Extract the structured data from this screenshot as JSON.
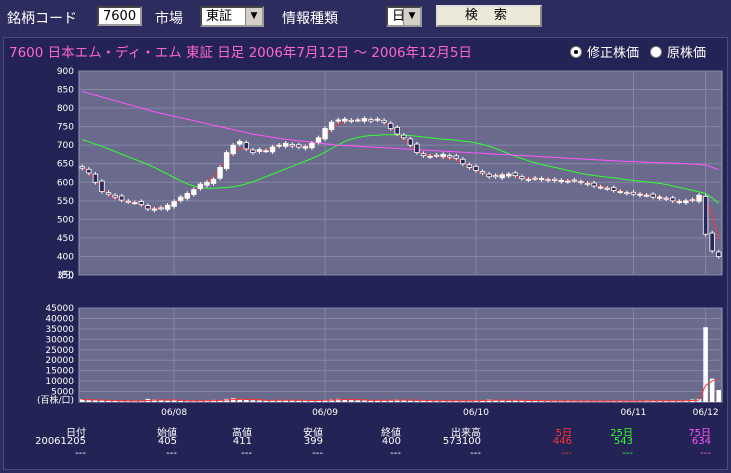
{
  "toolbar": {
    "code_label": "銘柄コード",
    "code_value": "7600",
    "market_label": "市場",
    "market_value": "東証",
    "info_label": "情報種類",
    "info_value": "日足",
    "search_label": "検 索"
  },
  "header": {
    "title": "7600 日本エム・ディ・エム 東証 日足 2006年7月12日 ～ 2006年12月5日",
    "radio_adjusted": "修正株価",
    "radio_raw": "原株価",
    "adjusted_selected": true
  },
  "colors": {
    "background": "#2c2c5e",
    "plot": "#6a6a8c",
    "ma5": "#ff3333",
    "ma25": "#33ff33",
    "ma75": "#ff55ff",
    "title": "#ff66cc"
  },
  "chart_data": [
    {
      "type": "candlestick",
      "y_unit": "(円)",
      "ylim": [
        350,
        900
      ],
      "y_ticks": [
        900,
        850,
        800,
        750,
        700,
        650,
        600,
        550,
        500,
        450,
        400,
        350
      ],
      "grid": true,
      "series": [
        {
          "name": "5日",
          "color": "#ff3333",
          "values": [
            640,
            625,
            605,
            588,
            565,
            558,
            553,
            548,
            546,
            540,
            532,
            530,
            530,
            535,
            545,
            555,
            565,
            577,
            590,
            600,
            615,
            635,
            660,
            680,
            692,
            690,
            685,
            683,
            687,
            693,
            698,
            700,
            698,
            697,
            696,
            700,
            710,
            725,
            743,
            758,
            765,
            767,
            767,
            768,
            768,
            770,
            765,
            750,
            730,
            715,
            698,
            685,
            677,
            672,
            670,
            668,
            665,
            660,
            652,
            643,
            633,
            625,
            618,
            618,
            620,
            620,
            617,
            612,
            610,
            610,
            609,
            608,
            606,
            605,
            605,
            604,
            602,
            598,
            594,
            590,
            585,
            580,
            577,
            572,
            570,
            568,
            566,
            563,
            560,
            555,
            550,
            548,
            548,
            552,
            560,
            560,
            510,
            446
          ]
        },
        {
          "name": "25日",
          "color": "#33ff33",
          "values": [
            715,
            709,
            703,
            697,
            690,
            683,
            676,
            669,
            662,
            655,
            648,
            640,
            631,
            622,
            613,
            604,
            596,
            590,
            586,
            584,
            584,
            585,
            586,
            588,
            591,
            596,
            601,
            608,
            615,
            622,
            629,
            636,
            643,
            650,
            657,
            664,
            672,
            681,
            691,
            701,
            710,
            716,
            721,
            724,
            726,
            727,
            728,
            728,
            728,
            727,
            726,
            724,
            722,
            720,
            718,
            716,
            715,
            713,
            711,
            709,
            706,
            702,
            697,
            691,
            684,
            677,
            670,
            664,
            658,
            653,
            648,
            644,
            640,
            636,
            632,
            628,
            624,
            621,
            618,
            616,
            614,
            612,
            609,
            607,
            605,
            603,
            601,
            599,
            597,
            594,
            590,
            586,
            582,
            578,
            574,
            570,
            558,
            543
          ]
        },
        {
          "name": "75日",
          "color": "#ff55ff",
          "values": [
            845,
            840,
            835,
            830,
            825,
            820,
            815,
            810,
            805,
            800,
            795,
            790,
            786,
            782,
            778,
            774,
            770,
            766,
            762,
            758,
            754,
            750,
            746,
            742,
            738,
            734,
            730,
            727,
            724,
            721,
            718,
            716,
            714,
            712,
            710,
            708,
            706,
            704,
            702,
            700,
            699,
            698,
            697,
            696,
            695,
            694,
            693,
            692,
            691,
            690,
            689,
            688,
            687,
            686,
            685,
            684,
            683,
            682,
            681,
            680,
            679,
            678,
            677,
            676,
            675,
            674,
            673,
            672,
            671,
            670,
            669,
            668,
            667,
            666,
            665,
            664,
            663,
            662,
            661,
            660,
            659,
            658,
            657,
            656,
            656,
            655,
            654,
            653,
            653,
            652,
            652,
            651,
            650,
            649,
            648,
            646,
            640,
            634
          ]
        }
      ],
      "closes": [
        638,
        625,
        600,
        575,
        568,
        560,
        552,
        548,
        545,
        540,
        528,
        528,
        530,
        538,
        548,
        560,
        570,
        580,
        595,
        600,
        608,
        640,
        680,
        700,
        710,
        690,
        680,
        688,
        685,
        695,
        700,
        705,
        698,
        695,
        696,
        705,
        720,
        745,
        762,
        768,
        770,
        765,
        768,
        772,
        765,
        770,
        762,
        745,
        730,
        720,
        700,
        680,
        672,
        670,
        672,
        675,
        668,
        665,
        650,
        640,
        632,
        625,
        615,
        615,
        620,
        622,
        618,
        610,
        608,
        610,
        610,
        605,
        605,
        605,
        603,
        605,
        600,
        595,
        590,
        587,
        583,
        578,
        575,
        570,
        568,
        568,
        565,
        560,
        560,
        555,
        550,
        548,
        550,
        552,
        565,
        460,
        415,
        400
      ]
    },
    {
      "type": "bar",
      "y_unit": "(百株/口)",
      "ylim": [
        0,
        45000
      ],
      "y_ticks": [
        45000,
        40000,
        35000,
        30000,
        25000,
        20000,
        15000,
        10000,
        5000
      ],
      "x_tick_labels": [
        "06/08",
        "06/09",
        "06/10",
        "06/11",
        "06/12"
      ],
      "volumes": [
        1200,
        900,
        800,
        700,
        600,
        500,
        400,
        500,
        600,
        700,
        1500,
        1200,
        800,
        600,
        700,
        500,
        400,
        500,
        600,
        800,
        1000,
        900,
        1500,
        1800,
        1200,
        900,
        800,
        700,
        600,
        900,
        1000,
        800,
        700,
        600,
        700,
        800,
        900,
        1000,
        1200,
        1500,
        1100,
        900,
        800,
        700,
        600,
        800,
        900,
        1000,
        1200,
        800,
        600,
        500,
        700,
        800,
        600,
        500,
        400,
        600,
        500,
        700,
        800,
        900,
        1200,
        800,
        700,
        600,
        1000,
        800,
        600,
        500,
        400,
        500,
        600,
        700,
        500,
        400,
        300,
        400,
        500,
        600,
        500,
        400,
        300,
        400,
        500,
        600,
        800,
        700,
        500,
        400,
        600,
        500,
        800,
        1200,
        1500,
        35800,
        11200,
        5731
      ]
    }
  ],
  "info_table": {
    "headers": [
      "日付",
      "始値",
      "高値",
      "安値",
      "終値",
      "出来高",
      "5日",
      "25日",
      "75日"
    ],
    "row1": [
      "20061205",
      "405",
      "411",
      "399",
      "400",
      "573100",
      "446",
      "543",
      "634"
    ],
    "row2": [
      "---",
      "---",
      "---",
      "---",
      "---",
      "---",
      "---",
      "---",
      "---"
    ]
  }
}
